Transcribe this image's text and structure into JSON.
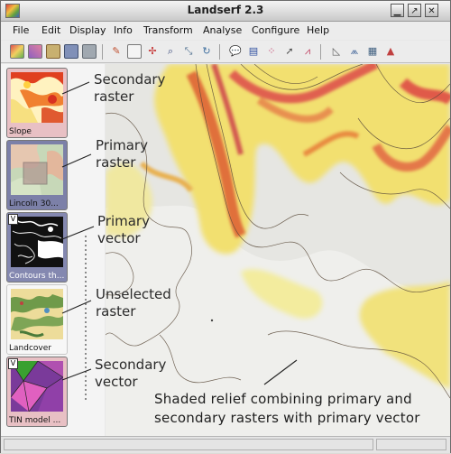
{
  "window": {
    "title": "Landserf 2.3"
  },
  "menu": [
    "File",
    "Edit",
    "Display",
    "Info",
    "Transform",
    "Analyse",
    "Configure",
    "Help"
  ],
  "toolbar": {
    "buttons": [
      "raster-new-icon",
      "raster-open-icon",
      "folder-open-icon",
      "save-icon",
      "print-icon",
      "pencil-icon",
      "notes-icon",
      "move-icon",
      "zoom-icon",
      "pan-icon",
      "refresh-icon",
      "speech-bubble-icon",
      "query-icon",
      "scatter-plot-icon",
      "select-arrow-icon",
      "profile-chart-icon",
      "triangle-icon",
      "peaks-icon",
      "grid-icon",
      "terrain-icon"
    ]
  },
  "layers": [
    {
      "label": "Slope",
      "vector": false
    },
    {
      "label": "Lincoln 30...",
      "vector": false
    },
    {
      "label": "Contours th...",
      "vector": true
    },
    {
      "label": "Landcover",
      "vector": false
    },
    {
      "label": "TIN model ...",
      "vector": true
    }
  ],
  "annotations": {
    "secondary_raster": [
      "Secondary",
      "raster"
    ],
    "primary_raster": [
      "Primary",
      "raster"
    ],
    "primary_vector": [
      "Primary",
      "vector"
    ],
    "unselected_raster": [
      "Unselected",
      "raster"
    ],
    "secondary_vector": [
      "Secondary",
      "vector"
    ],
    "shaded_relief": [
      "Shaded relief  combining  primary and",
      "secondary rasters with primary vector"
    ]
  }
}
